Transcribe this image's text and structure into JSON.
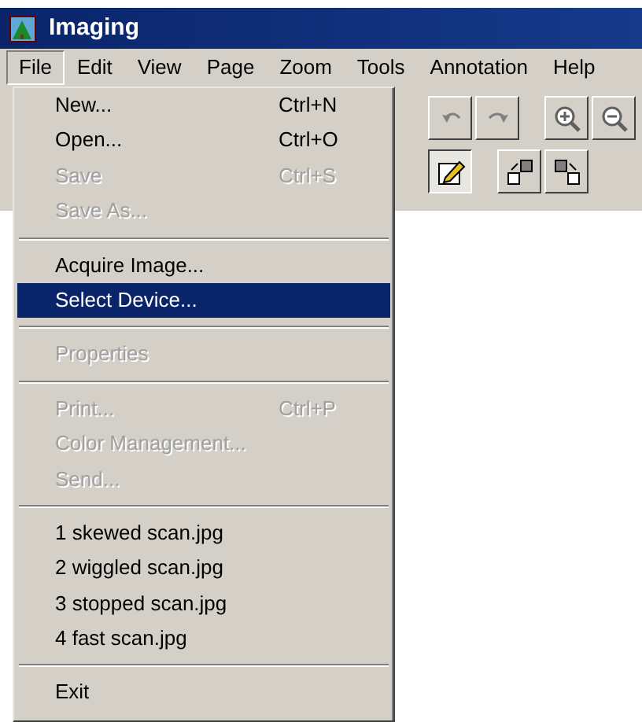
{
  "window": {
    "title": "Imaging"
  },
  "menu_bar": [
    {
      "label": "File",
      "selected": true
    },
    {
      "label": "Edit",
      "selected": false
    },
    {
      "label": "View",
      "selected": false
    },
    {
      "label": "Page",
      "selected": false
    },
    {
      "label": "Zoom",
      "selected": false
    },
    {
      "label": "Tools",
      "selected": false
    },
    {
      "label": "Annotation",
      "selected": false
    },
    {
      "label": "Help",
      "selected": false
    }
  ],
  "file_menu": [
    {
      "kind": "item",
      "label": "New...",
      "shortcut": "Ctrl+N",
      "disabled": false,
      "selected": false
    },
    {
      "kind": "item",
      "label": "Open...",
      "shortcut": "Ctrl+O",
      "disabled": false,
      "selected": false
    },
    {
      "kind": "item",
      "label": "Save",
      "shortcut": "Ctrl+S",
      "disabled": true,
      "selected": false
    },
    {
      "kind": "item",
      "label": "Save As...",
      "disabled": true,
      "selected": false
    },
    {
      "kind": "separator"
    },
    {
      "kind": "item",
      "label": "Acquire Image...",
      "disabled": false,
      "selected": false
    },
    {
      "kind": "item",
      "label": "Select Device...",
      "disabled": false,
      "selected": true
    },
    {
      "kind": "separator"
    },
    {
      "kind": "item",
      "label": "Properties",
      "disabled": true,
      "selected": false
    },
    {
      "kind": "separator"
    },
    {
      "kind": "item",
      "label": "Print...",
      "shortcut": "Ctrl+P",
      "disabled": true,
      "selected": false
    },
    {
      "kind": "item",
      "label": "Color Management...",
      "disabled": true,
      "selected": false
    },
    {
      "kind": "item",
      "label": "Send...",
      "disabled": true,
      "selected": false
    },
    {
      "kind": "separator"
    },
    {
      "kind": "item",
      "label": "1 skewed scan.jpg",
      "disabled": false,
      "selected": false
    },
    {
      "kind": "item",
      "label": "2 wiggled scan.jpg",
      "disabled": false,
      "selected": false
    },
    {
      "kind": "item",
      "label": "3 stopped scan.jpg",
      "disabled": false,
      "selected": false
    },
    {
      "kind": "item",
      "label": "4 fast scan.jpg",
      "disabled": false,
      "selected": false
    },
    {
      "kind": "separator"
    },
    {
      "kind": "item",
      "label": "Exit",
      "disabled": false,
      "selected": false
    }
  ],
  "toolbar_rows": [
    [
      {
        "kind": "undo",
        "pressed": false
      },
      {
        "kind": "redo",
        "pressed": false
      },
      {
        "kind": "zoom-in",
        "pressed": false
      },
      {
        "kind": "zoom-out",
        "pressed": false
      }
    ],
    [
      {
        "kind": "annotate",
        "pressed": true
      },
      {
        "kind": "page-left",
        "pressed": false
      },
      {
        "kind": "page-right",
        "pressed": false
      }
    ]
  ]
}
